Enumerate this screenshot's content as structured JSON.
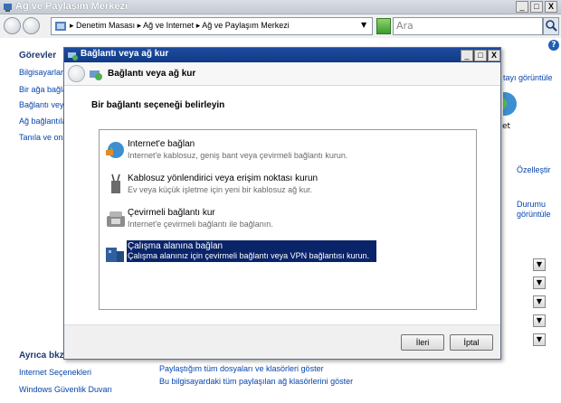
{
  "main_window": {
    "title": "Ağ ve Paylaşım Merkezi",
    "controls": {
      "minimize": "_",
      "maximize": "□",
      "close": "X"
    }
  },
  "address_bar": {
    "breadcrumb": [
      "Denetim Masası",
      "Ağ ve Internet",
      "Ağ ve Paylaşım Merkezi"
    ],
    "separator": "▸"
  },
  "search": {
    "placeholder": "Ara"
  },
  "left_pane": {
    "tasks_heading": "Görevler",
    "tasks": [
      "Bilgisayarları",
      "Bir ağa bağla",
      "Bağlantı veya",
      "Ağ bağlantıla",
      "Tanıla ve ona"
    ],
    "see_also_heading": "Ayrıca bkz.",
    "see_also": [
      "Internet Seçenekleri",
      "Windows Güvenlik Duvarı"
    ]
  },
  "right_pane": {
    "view_full_map": "tayı görüntüle",
    "net_label": "et",
    "customize": "Özelleştir",
    "view_status": [
      "Durumu",
      "görüntüle"
    ]
  },
  "bottom_links": [
    "Paylaştığım tüm dosyaları ve klasörleri göster",
    "Bu bilgisayardaki tüm paylaşılan ağ klasörlerini göster"
  ],
  "dialog": {
    "window_title": "Bağlantı veya ağ kur",
    "nav_title": "Bağlantı veya ağ kur",
    "heading": "Bir bağlantı seçeneği belirleyin",
    "options": [
      {
        "title": "Internet'e bağlan",
        "desc": "Internet'e kablosuz, geniş bant veya çevirmeli bağlantı kurun.",
        "icon": "globe-icon"
      },
      {
        "title": "Kablosuz yönlendirici veya erişim noktası kurun",
        "desc": "Ev veya küçük işletme için yeni bir kablosuz ağ kur.",
        "icon": "router-icon"
      },
      {
        "title": "Çevirmeli bağlantı kur",
        "desc": "Internet'e çevirmeli bağlantı ile bağlanın.",
        "icon": "phone-icon"
      },
      {
        "title": "Çalışma alanına bağlan",
        "desc": "Çalışma alanınız için çevirmeli bağlantı veya VPN bağlantısı kurun.",
        "icon": "workplace-icon"
      }
    ],
    "next_label": "İleri",
    "cancel_label": "İptal",
    "controls": {
      "minimize": "_",
      "maximize": "□",
      "close": "X"
    }
  },
  "colors": {
    "selection": "#0a246a",
    "link": "#0645ad",
    "dialog_title": "#1d4b9e"
  }
}
